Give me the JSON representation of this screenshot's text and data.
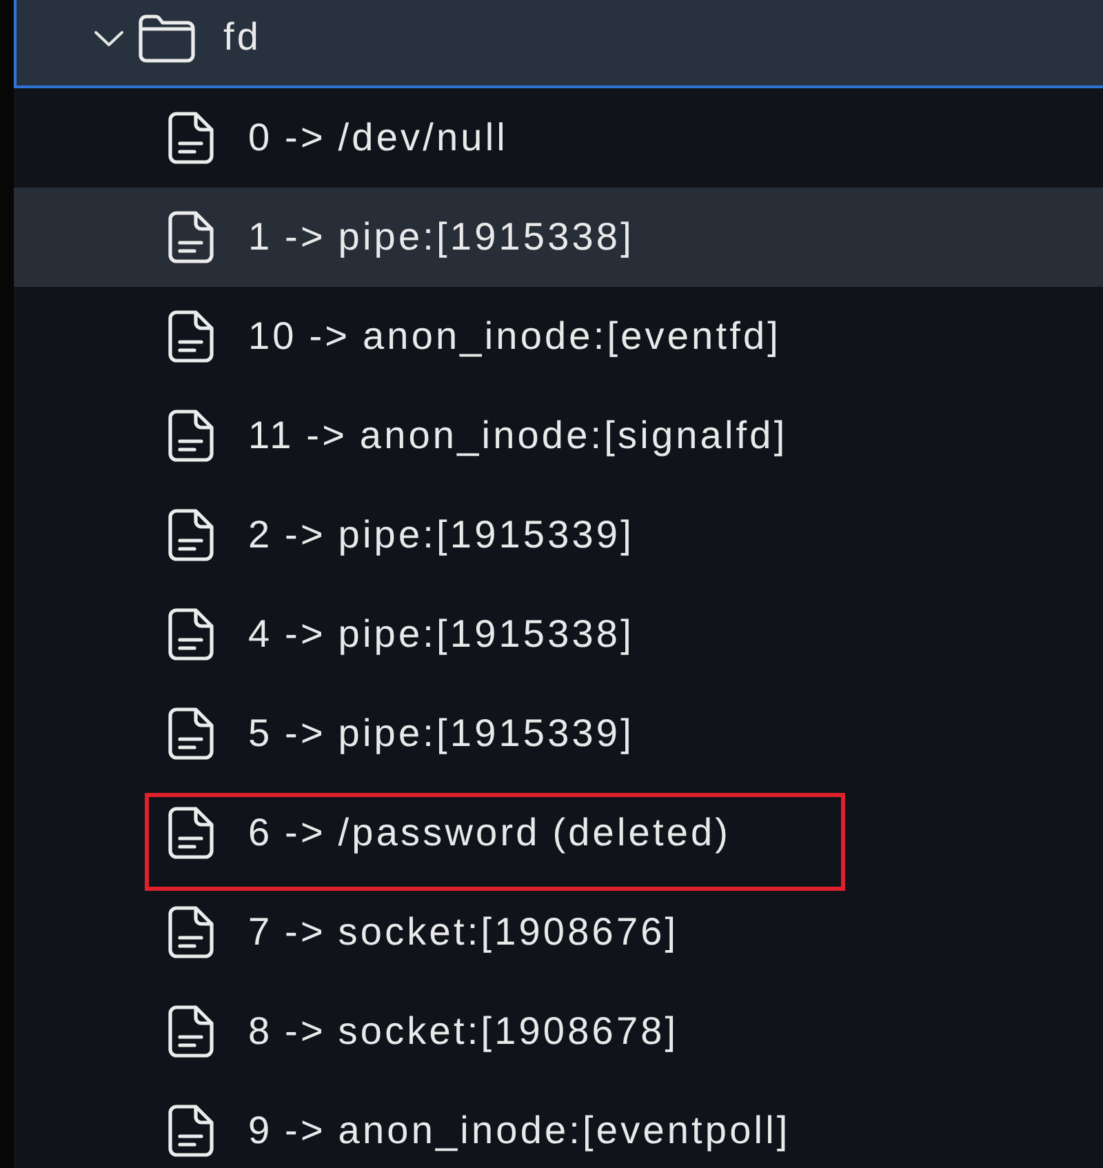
{
  "tree": [
    {
      "kind": "folder",
      "label": "fd",
      "expanded": true,
      "selected": true,
      "children": [
        {
          "kind": "file",
          "label": "0 -> /dev/null",
          "selected": false,
          "hovered": false,
          "marked": false
        },
        {
          "kind": "file",
          "label": "1 -> pipe:[1915338]",
          "selected": false,
          "hovered": true,
          "marked": false
        },
        {
          "kind": "file",
          "label": "10 -> anon_inode:[eventfd]",
          "selected": false,
          "hovered": false,
          "marked": false
        },
        {
          "kind": "file",
          "label": "11 -> anon_inode:[signalfd]",
          "selected": false,
          "hovered": false,
          "marked": false
        },
        {
          "kind": "file",
          "label": "2 -> pipe:[1915339]",
          "selected": false,
          "hovered": false,
          "marked": false
        },
        {
          "kind": "file",
          "label": "4 -> pipe:[1915338]",
          "selected": false,
          "hovered": false,
          "marked": false
        },
        {
          "kind": "file",
          "label": "5 -> pipe:[1915339]",
          "selected": false,
          "hovered": false,
          "marked": false
        },
        {
          "kind": "file",
          "label": "6 -> /password (deleted)",
          "selected": false,
          "hovered": false,
          "marked": true
        },
        {
          "kind": "file",
          "label": "7 -> socket:[1908676]",
          "selected": false,
          "hovered": false,
          "marked": false
        },
        {
          "kind": "file",
          "label": "8 -> socket:[1908678]",
          "selected": false,
          "hovered": false,
          "marked": false
        },
        {
          "kind": "file",
          "label": "9 -> anon_inode:[eventpoll]",
          "selected": false,
          "hovered": false,
          "marked": false
        }
      ]
    }
  ]
}
